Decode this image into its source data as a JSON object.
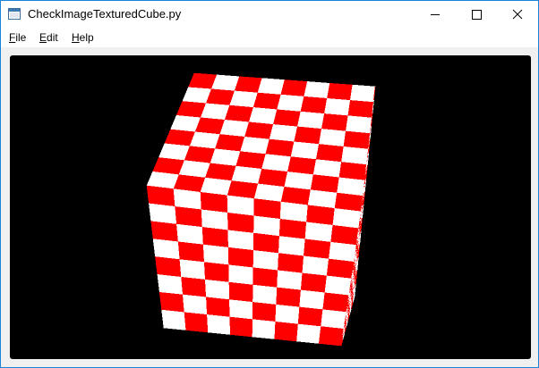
{
  "window": {
    "title": "CheckImageTexturedCube.py",
    "app_icon": "window-icon",
    "controls": {
      "minimize_icon": "minimize-icon",
      "maximize_icon": "maximize-icon",
      "close_icon": "close-icon"
    },
    "border_color": "#1883d7"
  },
  "menubar": {
    "file": {
      "mnemonic": "F",
      "rest": "ile"
    },
    "edit": {
      "mnemonic": "E",
      "rest": "dit"
    },
    "help": {
      "mnemonic": "H",
      "rest": "elp"
    }
  },
  "scene": {
    "background_color": "#000000",
    "texture_colors": [
      "#ff0000",
      "#ffffff"
    ],
    "object": "cube"
  }
}
